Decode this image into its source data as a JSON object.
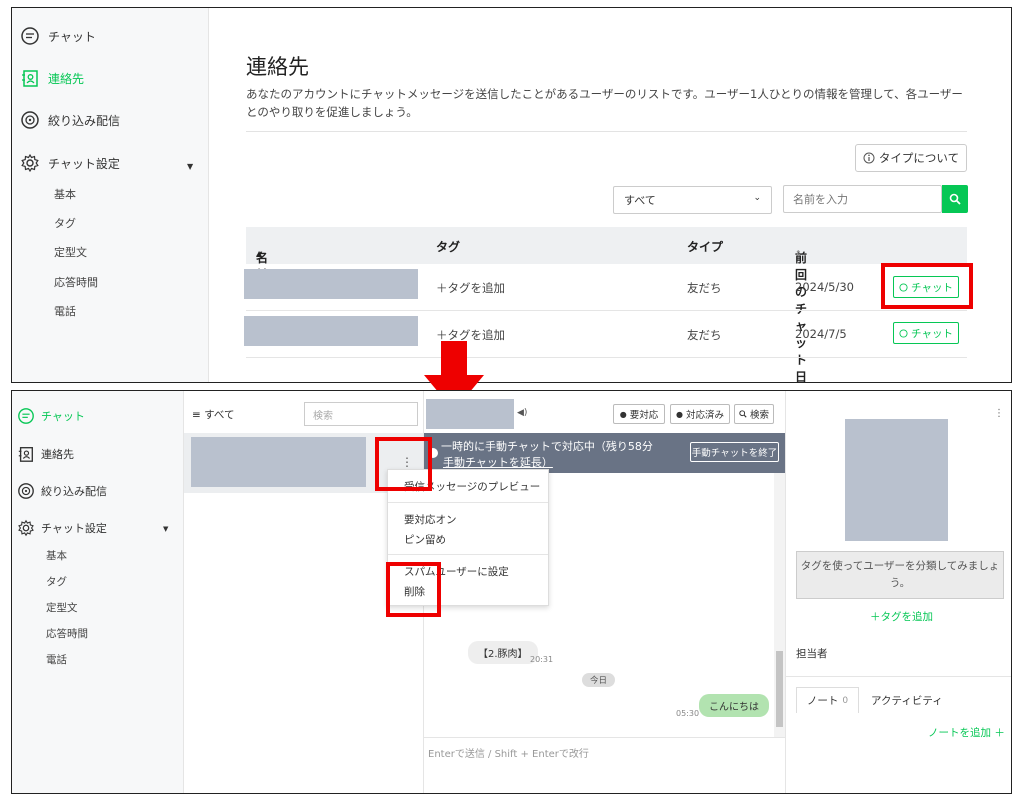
{
  "top": {
    "sidebar": {
      "items": [
        {
          "label": "チャット",
          "icon": "chat-bubble-icon"
        },
        {
          "label": "連絡先",
          "icon": "contact-card-icon",
          "active": true
        },
        {
          "label": "絞り込み配信",
          "icon": "broadcast-icon"
        },
        {
          "label": "チャット設定",
          "icon": "gear-icon"
        }
      ],
      "sub_items": [
        "基本",
        "タグ",
        "定型文",
        "応答時間",
        "電話"
      ]
    },
    "page_title": "連絡先",
    "description": "あなたのアカウントにチャットメッセージを送信したことがあるユーザーのリストです。ユーザー1人ひとりの情報を管理して、各ユーザーとのやり取りを促進しましょう。",
    "type_button": "タイプについて",
    "filter_select": "すべて",
    "name_placeholder": "名前を入力",
    "table": {
      "headers": [
        "名前",
        "タグ",
        "タイプ",
        "前回のチャット日"
      ],
      "rows": [
        {
          "tag_action": "＋タグを追加",
          "type": "友だち",
          "date": "2024/5/30",
          "button": "チャット"
        },
        {
          "tag_action": "＋タグを追加",
          "type": "友だち",
          "date": "2024/7/5",
          "button": "チャット"
        }
      ]
    }
  },
  "bottom": {
    "sidebar": {
      "items": [
        {
          "label": "チャット",
          "icon": "chat-bubble-icon",
          "active": true
        },
        {
          "label": "連絡先",
          "icon": "contact-card-icon"
        },
        {
          "label": "絞り込み配信",
          "icon": "broadcast-icon"
        },
        {
          "label": "チャット設定",
          "icon": "gear-icon"
        }
      ],
      "sub_items": [
        "基本",
        "タグ",
        "定型文",
        "応答時間",
        "電話"
      ]
    },
    "list": {
      "filter_label": "≡ すべて",
      "search_placeholder": "検索"
    },
    "chat_header": {
      "buttons": [
        "要対応",
        "対応済み",
        "検索"
      ]
    },
    "banner": {
      "line1": "一時的に手動チャットで対応中（残り58分",
      "line2": "手動チャットを延長）",
      "end_button": "手動チャットを終了"
    },
    "context_menu": {
      "items": [
        "受信メッセージのプレビュー",
        "要対応オン",
        "ピン留め",
        "スパムユーザーに設定",
        "削除"
      ]
    },
    "messages": {
      "incoming": "【2.豚肉】",
      "incoming_time": "20:31",
      "date_divider": "今日",
      "outgoing": "こんにちは",
      "outgoing_time": "05:30"
    },
    "composer_placeholder": "Enterで送信 / Shift + Enterで改行",
    "profile": {
      "tag_hint": "タグを使ってユーザーを分類してみましょう。",
      "add_tag": "＋タグを追加",
      "assignee_label": "担当者",
      "tab_note": "ノート",
      "tab_note_count": "0",
      "tab_activity": "アクティビティ",
      "add_note": "ノートを追加 ＋"
    }
  },
  "colors": {
    "brand_green": "#06c755",
    "highlight_red": "#ee0000",
    "banner_gray": "#697385"
  }
}
